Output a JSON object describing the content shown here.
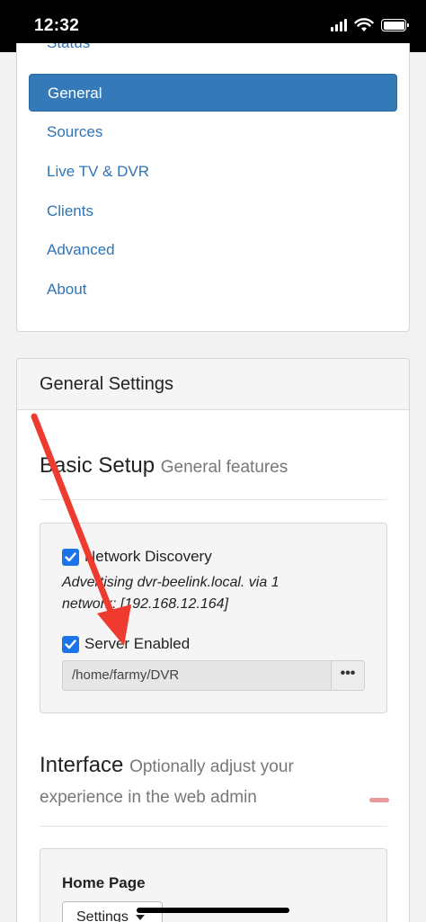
{
  "status_bar": {
    "time": "12:32"
  },
  "nav": {
    "items": [
      {
        "label": "Status"
      },
      {
        "label": "General",
        "active": true
      },
      {
        "label": "Sources"
      },
      {
        "label": "Live TV & DVR"
      },
      {
        "label": "Clients"
      },
      {
        "label": "Advanced"
      },
      {
        "label": "About"
      }
    ]
  },
  "settings": {
    "header": "General Settings",
    "basic_setup": {
      "title": "Basic Setup",
      "subtitle": "General features",
      "network_discovery": {
        "label": "Network Discovery",
        "checked": true
      },
      "advertising_note": "Advertising dvr-beelink.local. via 1 network: [192.168.12.164]",
      "server_enabled": {
        "label": "Server Enabled",
        "checked": true
      },
      "path_value": "/home/farmy/DVR",
      "browse_button": "•••"
    },
    "interface": {
      "title": "Interface",
      "subtitle": "Optionally adjust your experience in the web admin"
    },
    "home_page": {
      "label": "Home Page",
      "select_value": "Settings"
    }
  },
  "annotation_color": "#ee3a2f",
  "accent_color": "#357ab8",
  "link_color": "#2f74b5"
}
